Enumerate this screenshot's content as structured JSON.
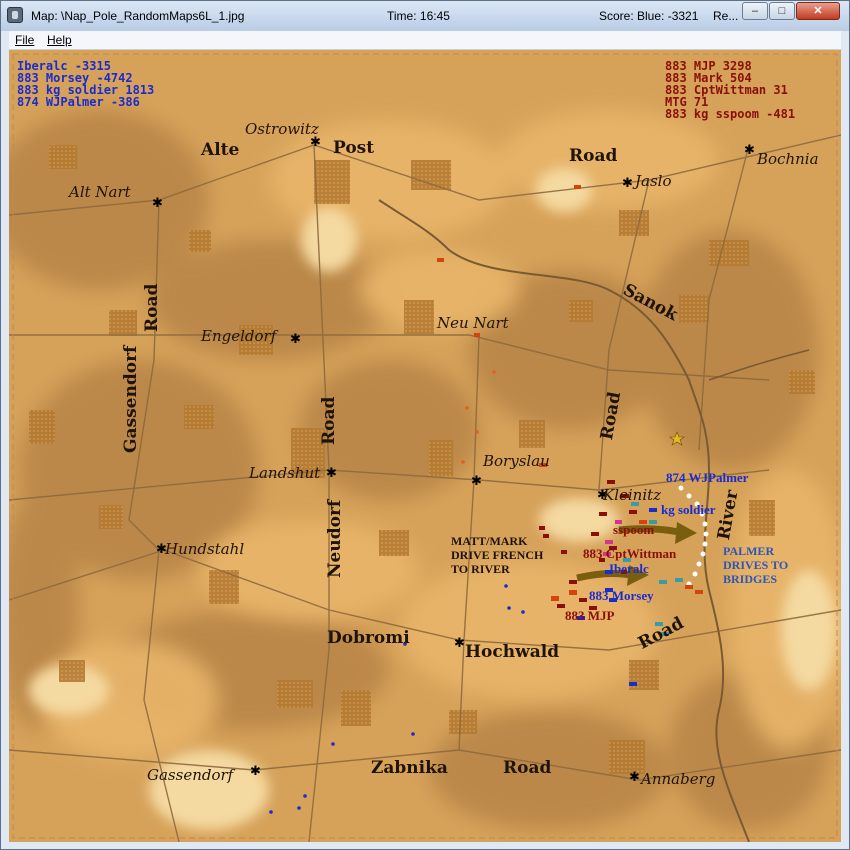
{
  "window": {
    "title": "Map: \\Nap_Pole_RandomMaps6L_1.jpg",
    "time": "Time: 16:45",
    "score": "Score: Blue: -3321",
    "extra": "Re...",
    "minimize": "–",
    "maximize": "□",
    "close": "✕"
  },
  "menu": {
    "file": "File",
    "help": "Help"
  },
  "scoreboard": {
    "blue": [
      "Iberalc  -3315",
      "883 Morsey  -4742",
      "883 kg soldier  1813",
      "874 WJPalmer  -386"
    ],
    "red": [
      "883 MJP  3298",
      "883 Mark  504",
      "883 CptWittman  31",
      "MTG  71",
      "883 kg sspoom  -481"
    ]
  },
  "places": {
    "ostrowitz": "Ostrowitz",
    "alte": "Alte",
    "post": "Post",
    "alt_nart": "Alt Nart",
    "road_north": "Road",
    "jaslo": "Jaslo",
    "bochnia": "Bochnia",
    "sanok": "Sanok",
    "neu_nart": "Neu Nart",
    "engeldorf": "Engeldorf",
    "gassendorf_road_a": "Gassendorf",
    "gassendorf_road_b": "Road",
    "road_center": "Road",
    "road_east": "Road",
    "landshut": "Landshut",
    "boryslau": "Boryslau",
    "kleinitz": "Kleinitz",
    "river": "River",
    "hundstahl": "Hundstahl",
    "neudorf": "Neudorf",
    "dobromi": "Dobromi",
    "hochwald": "Hochwald",
    "road_se": "Road",
    "gassendorf": "Gassendorf",
    "zabnika": "Zabnika",
    "road_south": "Road",
    "annaberg": "Annaberg"
  },
  "annotations": {
    "matt_mark": [
      "MATT/MARK",
      "DRIVE FRENCH",
      "TO RIVER"
    ],
    "palmer": [
      "PALMER",
      "DRIVES TO",
      "BRIDGES"
    ]
  },
  "unit_labels": {
    "wjpalmer": "874 WJPalmer",
    "soldier": "kg soldier",
    "sspoom": "sspoom",
    "cptwittman": "883 CptWittman",
    "iberalc": "Iberalc",
    "morsey": "883 Morsey",
    "mjp": "883 MJP"
  },
  "colors": {
    "blue_team": "#1a2bd0",
    "red_team": "#8a0f08",
    "map_base": "#d7a45c",
    "arrow": "#7a5e10",
    "palmer_note": "#2d56b8"
  }
}
